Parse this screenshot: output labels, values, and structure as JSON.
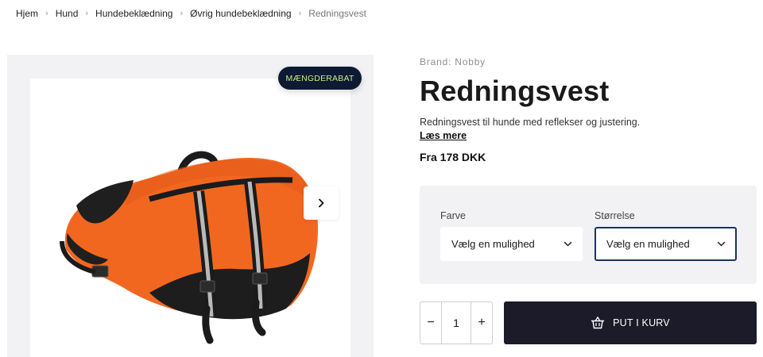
{
  "breadcrumb": {
    "items": [
      "Hjem",
      "Hund",
      "Hundebeklædning",
      "Øvrig hundebeklædning"
    ],
    "current": "Redningsvest",
    "separator_icon": "chevron-right-icon"
  },
  "gallery": {
    "badge": "MÆNGDERABAT",
    "next_icon": "chevron-right-icon",
    "image_subject": "orange dog life vest"
  },
  "product": {
    "brand": "Brand: Nobby",
    "title": "Redningsvest",
    "description": "Redningsvest til hunde med reflekser og justering.",
    "read_more": "Læs mere",
    "price": "Fra 178 DKK"
  },
  "options": {
    "color": {
      "label": "Farve",
      "value": "Vælg en mulighed"
    },
    "size": {
      "label": "Størrelse",
      "value": "Vælg en mulighed"
    }
  },
  "quantity": {
    "minus": "−",
    "value": "1",
    "plus": "+"
  },
  "cart": {
    "label": "PUT I KURV",
    "icon": "basket-icon"
  },
  "colors": {
    "badge_bg": "#0e1a33",
    "badge_text": "#c6f08a",
    "cart_bg": "#1c1b2a",
    "panel_bg": "#f2f2f4",
    "vest_orange": "#f2671f",
    "active_border": "#1d3461"
  }
}
